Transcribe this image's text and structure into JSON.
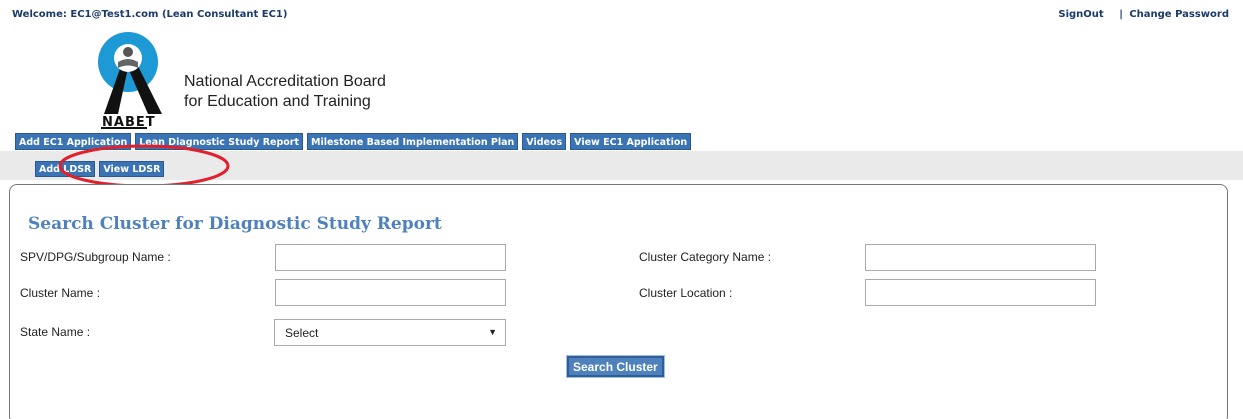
{
  "header": {
    "welcome_text": "Welcome: EC1@Test1.com (Lean Consultant EC1)",
    "signout_label": "SignOut",
    "separator": "|",
    "change_password_label": "Change Password"
  },
  "logo": {
    "wordmark": "NABET",
    "org_name_line1": "National Accreditation Board",
    "org_name_line2": "for Education and Training"
  },
  "main_nav": [
    {
      "label": "Add EC1 Application"
    },
    {
      "label": "Lean Diagnostic Study Report"
    },
    {
      "label": "Milestone Based Implementation Plan"
    },
    {
      "label": "Videos"
    },
    {
      "label": "View EC1 Application"
    }
  ],
  "sub_nav": [
    {
      "label": "Add LDSR"
    },
    {
      "label": "View LDSR"
    }
  ],
  "form": {
    "title": "Search Cluster for Diagnostic Study Report",
    "spv_label": "SPV/DPG/Subgroup Name :",
    "spv_value": "",
    "cluster_category_label": "Cluster Category Name :",
    "cluster_category_value": "",
    "cluster_name_label": "Cluster Name :",
    "cluster_name_value": "",
    "cluster_location_label": "Cluster Location :",
    "cluster_location_value": "",
    "state_label": "State Name :",
    "state_selected": "Select",
    "search_button": "Search Cluster"
  },
  "colors": {
    "nav_tab_bg": "#3b74b4",
    "title_blue": "#4f82bd",
    "annotation_red": "#e0202a",
    "logo_blue": "#1d9ad6"
  }
}
